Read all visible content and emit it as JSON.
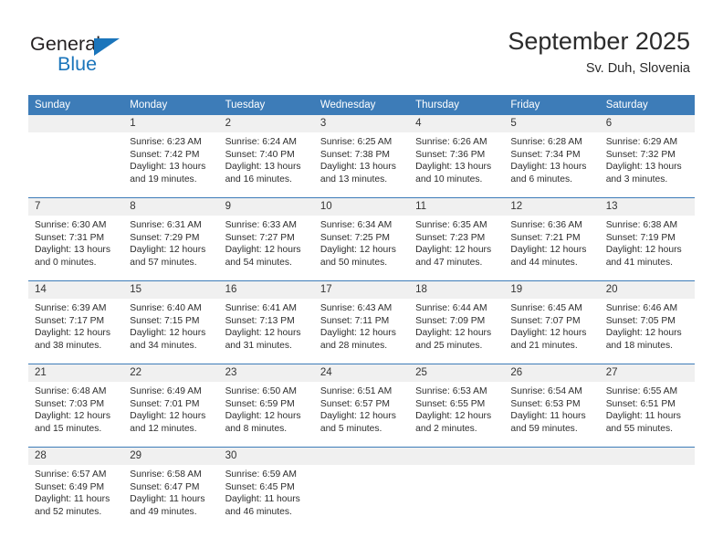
{
  "brand": {
    "name_top": "General",
    "name_bottom": "Blue",
    "accent_color": "#1b75bb"
  },
  "header": {
    "title": "September 2025",
    "location": "Sv. Duh, Slovenia"
  },
  "calendar": {
    "header_color": "#3d7cb8",
    "daynum_bg": "#f0f0f0",
    "weekday_headers": [
      "Sunday",
      "Monday",
      "Tuesday",
      "Wednesday",
      "Thursday",
      "Friday",
      "Saturday"
    ],
    "weeks": [
      [
        {
          "day": "",
          "lines": []
        },
        {
          "day": "1",
          "lines": [
            "Sunrise: 6:23 AM",
            "Sunset: 7:42 PM",
            "Daylight: 13 hours",
            "and 19 minutes."
          ]
        },
        {
          "day": "2",
          "lines": [
            "Sunrise: 6:24 AM",
            "Sunset: 7:40 PM",
            "Daylight: 13 hours",
            "and 16 minutes."
          ]
        },
        {
          "day": "3",
          "lines": [
            "Sunrise: 6:25 AM",
            "Sunset: 7:38 PM",
            "Daylight: 13 hours",
            "and 13 minutes."
          ]
        },
        {
          "day": "4",
          "lines": [
            "Sunrise: 6:26 AM",
            "Sunset: 7:36 PM",
            "Daylight: 13 hours",
            "and 10 minutes."
          ]
        },
        {
          "day": "5",
          "lines": [
            "Sunrise: 6:28 AM",
            "Sunset: 7:34 PM",
            "Daylight: 13 hours",
            "and 6 minutes."
          ]
        },
        {
          "day": "6",
          "lines": [
            "Sunrise: 6:29 AM",
            "Sunset: 7:32 PM",
            "Daylight: 13 hours",
            "and 3 minutes."
          ]
        }
      ],
      [
        {
          "day": "7",
          "lines": [
            "Sunrise: 6:30 AM",
            "Sunset: 7:31 PM",
            "Daylight: 13 hours",
            "and 0 minutes."
          ]
        },
        {
          "day": "8",
          "lines": [
            "Sunrise: 6:31 AM",
            "Sunset: 7:29 PM",
            "Daylight: 12 hours",
            "and 57 minutes."
          ]
        },
        {
          "day": "9",
          "lines": [
            "Sunrise: 6:33 AM",
            "Sunset: 7:27 PM",
            "Daylight: 12 hours",
            "and 54 minutes."
          ]
        },
        {
          "day": "10",
          "lines": [
            "Sunrise: 6:34 AM",
            "Sunset: 7:25 PM",
            "Daylight: 12 hours",
            "and 50 minutes."
          ]
        },
        {
          "day": "11",
          "lines": [
            "Sunrise: 6:35 AM",
            "Sunset: 7:23 PM",
            "Daylight: 12 hours",
            "and 47 minutes."
          ]
        },
        {
          "day": "12",
          "lines": [
            "Sunrise: 6:36 AM",
            "Sunset: 7:21 PM",
            "Daylight: 12 hours",
            "and 44 minutes."
          ]
        },
        {
          "day": "13",
          "lines": [
            "Sunrise: 6:38 AM",
            "Sunset: 7:19 PM",
            "Daylight: 12 hours",
            "and 41 minutes."
          ]
        }
      ],
      [
        {
          "day": "14",
          "lines": [
            "Sunrise: 6:39 AM",
            "Sunset: 7:17 PM",
            "Daylight: 12 hours",
            "and 38 minutes."
          ]
        },
        {
          "day": "15",
          "lines": [
            "Sunrise: 6:40 AM",
            "Sunset: 7:15 PM",
            "Daylight: 12 hours",
            "and 34 minutes."
          ]
        },
        {
          "day": "16",
          "lines": [
            "Sunrise: 6:41 AM",
            "Sunset: 7:13 PM",
            "Daylight: 12 hours",
            "and 31 minutes."
          ]
        },
        {
          "day": "17",
          "lines": [
            "Sunrise: 6:43 AM",
            "Sunset: 7:11 PM",
            "Daylight: 12 hours",
            "and 28 minutes."
          ]
        },
        {
          "day": "18",
          "lines": [
            "Sunrise: 6:44 AM",
            "Sunset: 7:09 PM",
            "Daylight: 12 hours",
            "and 25 minutes."
          ]
        },
        {
          "day": "19",
          "lines": [
            "Sunrise: 6:45 AM",
            "Sunset: 7:07 PM",
            "Daylight: 12 hours",
            "and 21 minutes."
          ]
        },
        {
          "day": "20",
          "lines": [
            "Sunrise: 6:46 AM",
            "Sunset: 7:05 PM",
            "Daylight: 12 hours",
            "and 18 minutes."
          ]
        }
      ],
      [
        {
          "day": "21",
          "lines": [
            "Sunrise: 6:48 AM",
            "Sunset: 7:03 PM",
            "Daylight: 12 hours",
            "and 15 minutes."
          ]
        },
        {
          "day": "22",
          "lines": [
            "Sunrise: 6:49 AM",
            "Sunset: 7:01 PM",
            "Daylight: 12 hours",
            "and 12 minutes."
          ]
        },
        {
          "day": "23",
          "lines": [
            "Sunrise: 6:50 AM",
            "Sunset: 6:59 PM",
            "Daylight: 12 hours",
            "and 8 minutes."
          ]
        },
        {
          "day": "24",
          "lines": [
            "Sunrise: 6:51 AM",
            "Sunset: 6:57 PM",
            "Daylight: 12 hours",
            "and 5 minutes."
          ]
        },
        {
          "day": "25",
          "lines": [
            "Sunrise: 6:53 AM",
            "Sunset: 6:55 PM",
            "Daylight: 12 hours",
            "and 2 minutes."
          ]
        },
        {
          "day": "26",
          "lines": [
            "Sunrise: 6:54 AM",
            "Sunset: 6:53 PM",
            "Daylight: 11 hours",
            "and 59 minutes."
          ]
        },
        {
          "day": "27",
          "lines": [
            "Sunrise: 6:55 AM",
            "Sunset: 6:51 PM",
            "Daylight: 11 hours",
            "and 55 minutes."
          ]
        }
      ],
      [
        {
          "day": "28",
          "lines": [
            "Sunrise: 6:57 AM",
            "Sunset: 6:49 PM",
            "Daylight: 11 hours",
            "and 52 minutes."
          ]
        },
        {
          "day": "29",
          "lines": [
            "Sunrise: 6:58 AM",
            "Sunset: 6:47 PM",
            "Daylight: 11 hours",
            "and 49 minutes."
          ]
        },
        {
          "day": "30",
          "lines": [
            "Sunrise: 6:59 AM",
            "Sunset: 6:45 PM",
            "Daylight: 11 hours",
            "and 46 minutes."
          ]
        },
        {
          "day": "",
          "lines": []
        },
        {
          "day": "",
          "lines": []
        },
        {
          "day": "",
          "lines": []
        },
        {
          "day": "",
          "lines": []
        }
      ]
    ]
  }
}
